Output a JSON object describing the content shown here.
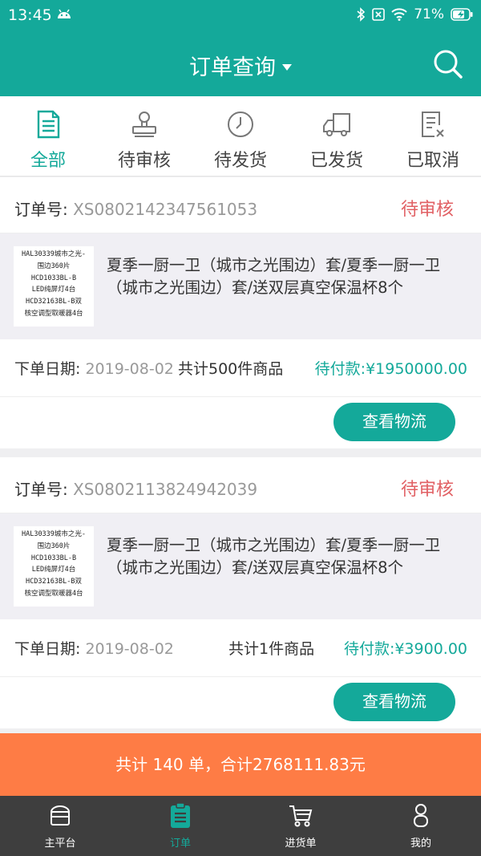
{
  "status_bar": {
    "time": "13:45",
    "battery": "71%",
    "icons": [
      "android-icon",
      "bluetooth-icon",
      "no-sim-icon",
      "wifi-icon",
      "battery-charging-icon"
    ]
  },
  "header": {
    "title": "订单查询",
    "icons": [
      "caret-down-icon",
      "search-icon"
    ]
  },
  "tabs": [
    {
      "label": "全部",
      "icon": "document-icon",
      "active": true
    },
    {
      "label": "待审核",
      "icon": "stamp-icon",
      "active": false
    },
    {
      "label": "待发货",
      "icon": "clock-icon",
      "active": false
    },
    {
      "label": "已发货",
      "icon": "truck-icon",
      "active": false
    },
    {
      "label": "已取消",
      "icon": "cancel-document-icon",
      "active": false
    }
  ],
  "orders": [
    {
      "order_label": "订单号: ",
      "order_number": "XS0802142347561053",
      "status": "待审核",
      "thumb_lines": [
        "HAL30339城市之光-",
        "围边360片",
        "HCD1033BL-B",
        "LED纯屏灯4台",
        "HCD32163BL-B双",
        "核空调型取暖器4台"
      ],
      "goods_name": "夏季一厨一卫（城市之光围边）套/夏季一厨一卫（城市之光围边）套/送双层真空保温杯8个",
      "date_label": "下单日期: ",
      "date": "2019-08-02",
      "total": "共计500件商品",
      "payable": "待付款:¥1950000.00",
      "button": "查看物流"
    },
    {
      "order_label": "订单号: ",
      "order_number": "XS0802113824942039",
      "status": "待审核",
      "thumb_lines": [
        "HAL30339城市之光-",
        "围边360片",
        "HCD1033BL-B",
        "LED纯屏灯4台",
        "HCD32163BL-B双",
        "核空调型取暖器4台"
      ],
      "goods_name": "夏季一厨一卫（城市之光围边）套/夏季一厨一卫（城市之光围边）套/送双层真空保温杯8个",
      "date_label": "下单日期: ",
      "date": "2019-08-02",
      "total": "共计1件商品",
      "payable": "待付款:¥3900.00",
      "button": "查看物流"
    }
  ],
  "summary": "共计 140 单，合计2768111.83元",
  "bottom_nav": [
    {
      "label": "主平台",
      "icon": "store-icon",
      "active": false
    },
    {
      "label": "订单",
      "icon": "clipboard-icon",
      "active": true
    },
    {
      "label": "进货单",
      "icon": "cart-icon",
      "active": false
    },
    {
      "label": "我的",
      "icon": "person-icon",
      "active": false
    }
  ],
  "colors": {
    "primary": "#14a99a",
    "status_red": "#e16064",
    "summary_bar": "#fe7c45",
    "bottom_nav_bg": "#3e3e3e"
  }
}
